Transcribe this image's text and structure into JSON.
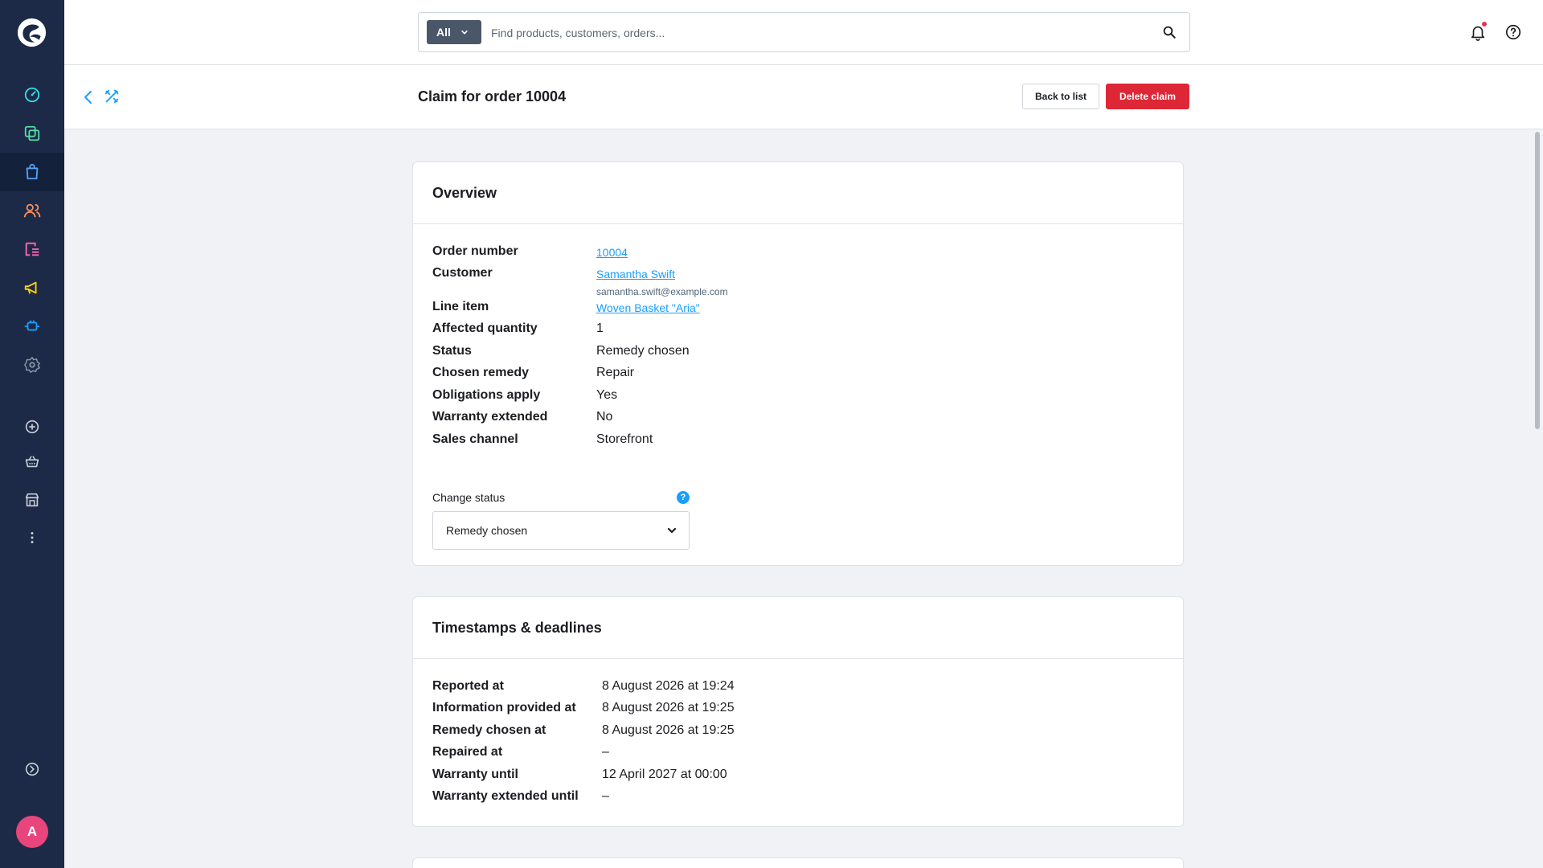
{
  "sidebar": {
    "nav": [
      {
        "name": "dashboard-icon",
        "color": "#37d9e6"
      },
      {
        "name": "catalogues-icon",
        "color": "#57d9a3"
      },
      {
        "name": "orders-icon",
        "color": "#4fa3ff"
      },
      {
        "name": "customers-icon",
        "color": "#ff8f5a"
      },
      {
        "name": "content-icon",
        "color": "#ff68b4"
      },
      {
        "name": "marketing-icon",
        "color": "#ffd700"
      },
      {
        "name": "extensions-icon",
        "color": "#189eff"
      },
      {
        "name": "settings-icon",
        "color": "#8a98ab"
      }
    ],
    "avatar_initial": "A"
  },
  "search": {
    "type_label": "All",
    "placeholder": "Find products, customers, orders..."
  },
  "header": {
    "title": "Claim for order 10004",
    "back_to_list": "Back to list",
    "delete_claim": "Delete claim"
  },
  "overview": {
    "title": "Overview",
    "order_number_label": "Order number",
    "order_number": "10004",
    "customer_label": "Customer",
    "customer_name": "Samantha Swift",
    "customer_email": "samantha.swift@example.com",
    "line_item_label": "Line item",
    "line_item": "Woven Basket \"Aria\"",
    "affected_quantity_label": "Affected quantity",
    "affected_quantity": "1",
    "status_label": "Status",
    "status": "Remedy chosen",
    "chosen_remedy_label": "Chosen remedy",
    "chosen_remedy": "Repair",
    "obligations_label": "Obligations apply",
    "obligations": "Yes",
    "warranty_extended_label": "Warranty extended",
    "warranty_extended": "No",
    "sales_channel_label": "Sales channel",
    "sales_channel": "Storefront",
    "change_status_label": "Change status",
    "change_status_value": "Remedy chosen"
  },
  "timestamps": {
    "title": "Timestamps & deadlines",
    "rows": [
      {
        "label": "Reported at",
        "value": "8 August 2026 at 19:24"
      },
      {
        "label": "Information provided at",
        "value": "8 August 2026 at 19:25"
      },
      {
        "label": "Remedy chosen at",
        "value": "8 August 2026 at 19:25"
      },
      {
        "label": "Repaired at",
        "value": "–"
      },
      {
        "label": "Warranty until",
        "value": "12 April 2027 at 00:00"
      },
      {
        "label": "Warranty extended until",
        "value": "–"
      }
    ]
  },
  "colors": {
    "sidebar": "#1c2a47",
    "primary": "#189eff",
    "danger": "#de2736"
  }
}
